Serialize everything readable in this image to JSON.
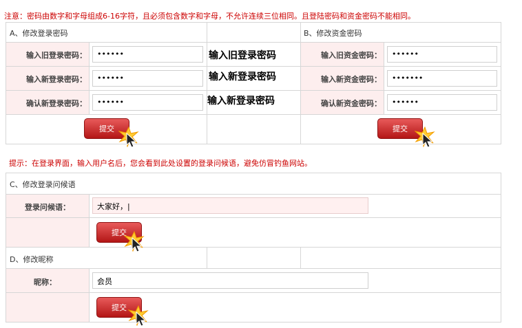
{
  "notice": "注意：密码由数字和字母组成6-16字符，且必须包含数字和字母，不允许连续三位相同。且登陆密码和资金密码不能相同。",
  "hint": "提示：在登录界面，输入用户名后，您会看到此处设置的登录问候语，避免仿冒钓鱼网站。",
  "section_a": {
    "title": "A、修改登录密码",
    "old_label": "输入旧登录密码：",
    "new_label": "输入新登录密码：",
    "confirm_label": "确认新登录密码：",
    "old_value": "••••••",
    "new_value": "••••••",
    "confirm_value": "••••••",
    "annot_old": "输入旧登录密码",
    "annot_new": "输入新登录密码",
    "annot_confirm": "输入新登录密码",
    "submit": "提交"
  },
  "section_b": {
    "title": "B、修改资金密码",
    "old_label": "输入旧资金密码：",
    "new_label": "输入新资金密码：",
    "confirm_label": "确认新资金密码：",
    "old_value": "••••••",
    "new_value": "•••••••",
    "confirm_value": "••••••",
    "submit": "提交"
  },
  "section_c": {
    "title": "C、修改登录问候语",
    "label": "登录问候语：",
    "value": "大家好，|",
    "submit": "提交"
  },
  "section_d": {
    "title": "D、修改昵称",
    "label": "昵称：",
    "value": "会员",
    "submit": "提交"
  },
  "icons": {
    "cursor": "click-cursor-icon"
  }
}
